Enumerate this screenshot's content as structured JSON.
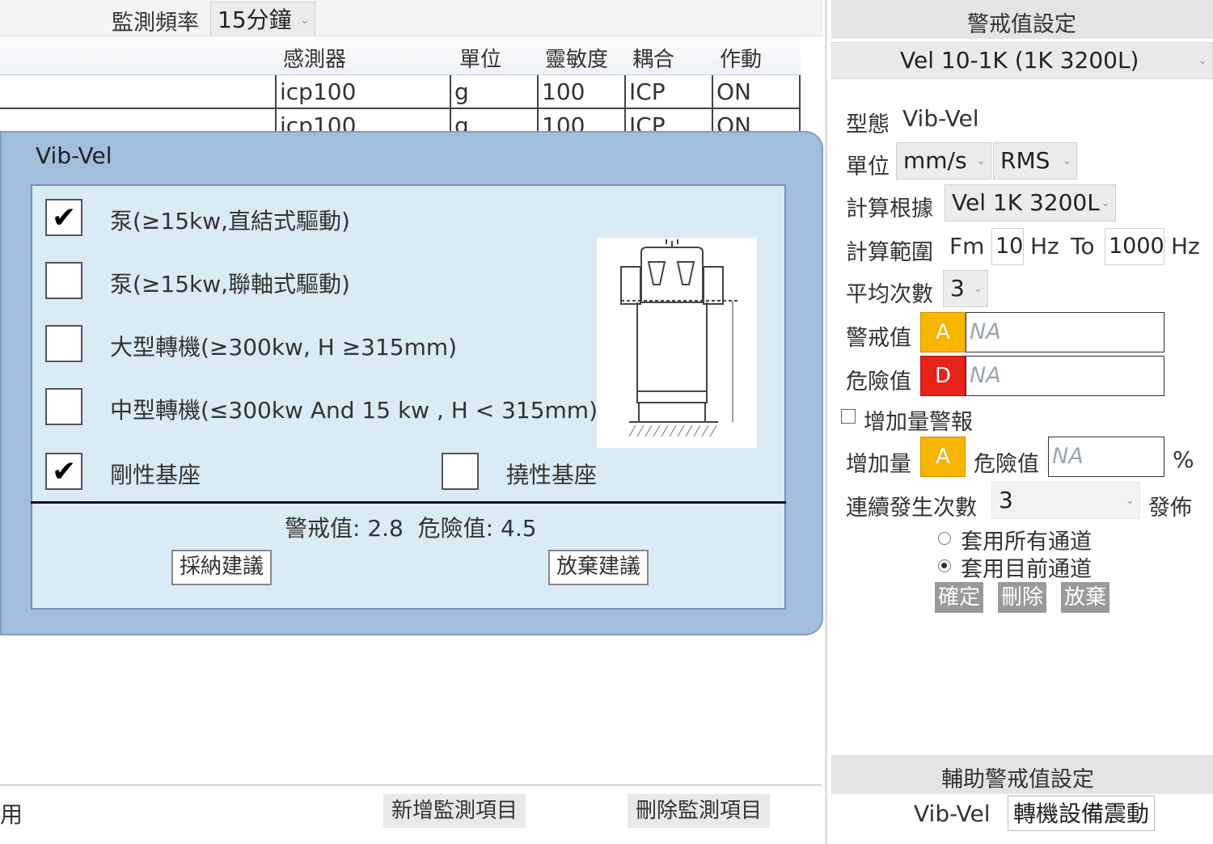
{
  "top": {
    "freq_label": "監測頻率",
    "freq_value": "15分鐘"
  },
  "table": {
    "headers": [
      "感測器",
      "單位",
      "靈敏度",
      "耦合",
      "作動"
    ],
    "rows": [
      [
        "icp100",
        "g",
        "100",
        "ICP",
        "ON"
      ],
      [
        "icp100",
        "g",
        "100",
        "ICP",
        "ON"
      ]
    ]
  },
  "dialog": {
    "title": "Vib-Vel",
    "options": [
      {
        "label": "泵(≥15kw,直結式驅動)",
        "checked": true
      },
      {
        "label": "泵(≥15kw,聯軸式驅動)",
        "checked": false
      },
      {
        "label": "大型轉機(≥300kw, H ≥315mm)",
        "checked": false
      },
      {
        "label": "中型轉機(≤300kw And 15 kw , H < 315mm)",
        "checked": false
      }
    ],
    "base_rigid": {
      "label": "剛性基座",
      "checked": true
    },
    "base_flexible": {
      "label": "撓性基座",
      "checked": false
    },
    "result": "警戒值: 2.8  危險值: 4.5",
    "accept_button": "採納建議",
    "reject_button": "放棄建議"
  },
  "bottom": {
    "partial_label": "用",
    "add_button": "新增監測項目",
    "delete_button": "刪除監測項目"
  },
  "alarm": {
    "header": "警戒值設定",
    "preset": "Vel 10-1K (1K 3200L)",
    "type_label": "型態",
    "type_value": "Vib-Vel",
    "unit_label": "單位",
    "unit_value": "mm/s",
    "unit_mode": "RMS",
    "basis_label": "計算根據",
    "basis_value": "Vel 1K 3200L",
    "range_label": "計算範圍",
    "fm": "Fm",
    "range_from": "10",
    "hz1": "Hz",
    "to": "To",
    "range_to": "1000",
    "hz2": "Hz",
    "avg_label": "平均次數",
    "avg_value": "3",
    "warn_label": "警戒值",
    "warn_badge": "A",
    "warn_value": "NA",
    "danger_label": "危險值",
    "danger_badge": "D",
    "danger_value": "NA",
    "inc_check_label": "增加量警報",
    "inc_label": "增加量",
    "inc_badge": "A",
    "inc_danger_label": "危險值",
    "inc_value": "NA",
    "percent": "%",
    "consec_label": "連續發生次數",
    "consec_value": "3",
    "publish_label": "發佈",
    "radio_all": "套用所有通道",
    "radio_current": "套用目前通道",
    "confirm": "確定",
    "delete": "刪除",
    "discard": "放棄",
    "aux_header": "輔助警戒值設定",
    "aux_type": "Vib-Vel",
    "aux_value": "轉機設備震動",
    "colors": {
      "warn": "#f7b500",
      "danger": "#e8211a"
    }
  }
}
